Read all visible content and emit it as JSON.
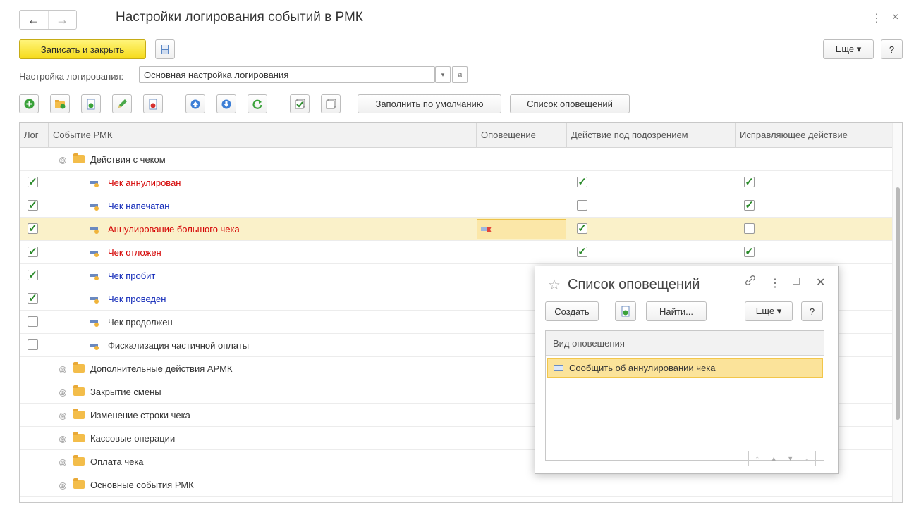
{
  "window": {
    "title": "Настройки логирования событий в РМК",
    "back_arrow": "←",
    "forward_arrow": "→",
    "more_icon": "⋮",
    "close_icon": "×"
  },
  "toolbar": {
    "save_close_label": "Записать и закрыть",
    "more_label": "Еще ▾",
    "help_label": "?"
  },
  "setting": {
    "label": "Настройка логирования:",
    "value": "Основная настройка логирования",
    "dropdown_icon": "▾",
    "open_icon": "⧉"
  },
  "actions": {
    "fill_default_label": "Заполнить по умолчанию",
    "notify_list_label": "Список оповещений"
  },
  "table": {
    "columns": [
      "Лог",
      "Событие РМК",
      "Оповещение",
      "Действие под подозрением",
      "Исправляющее действие"
    ],
    "rows": [
      {
        "type": "group",
        "expander": "⊖",
        "label": "Действия с чеком"
      },
      {
        "type": "event",
        "log": true,
        "label": "Чек аннулирован",
        "color": "#d40000",
        "suspect": true,
        "fix": true
      },
      {
        "type": "event",
        "log": true,
        "label": "Чек напечатан",
        "color": "#1028b8",
        "suspect": false,
        "fix": true
      },
      {
        "type": "event",
        "log": true,
        "label": "Аннулирование большого чека",
        "color": "#d40000",
        "suspect": true,
        "fix": false,
        "selected": true
      },
      {
        "type": "event",
        "log": true,
        "label": "Чек отложен",
        "color": "#d40000",
        "suspect": true,
        "fix": true
      },
      {
        "type": "event",
        "log": true,
        "label": "Чек пробит",
        "color": "#1028b8"
      },
      {
        "type": "event",
        "log": true,
        "label": "Чек проведен",
        "color": "#1028b8"
      },
      {
        "type": "event",
        "log": false,
        "label": "Чек продолжен",
        "color": "#333333"
      },
      {
        "type": "event",
        "log": false,
        "label": "Фискализация частичной оплаты",
        "color": "#333333"
      },
      {
        "type": "group",
        "expander": "⊕",
        "label": "Дополнительные действия АРМК"
      },
      {
        "type": "group",
        "expander": "⊕",
        "label": "Закрытие смены"
      },
      {
        "type": "group",
        "expander": "⊕",
        "label": "Изменение строки чека"
      },
      {
        "type": "group",
        "expander": "⊕",
        "label": "Кассовые операции"
      },
      {
        "type": "group",
        "expander": "⊕",
        "label": "Оплата чека"
      },
      {
        "type": "group",
        "expander": "⊕",
        "label": "Основные события РМК"
      }
    ]
  },
  "popup": {
    "star_icon": "☆",
    "title": "Список оповещений",
    "link_icon": "🔗",
    "more_icon": "⋮",
    "maximize_icon": "□",
    "close_icon": "✕",
    "create_label": "Создать",
    "find_label": "Найти...",
    "more_label": "Еще ▾",
    "help_label": "?",
    "column": "Вид оповещения",
    "item": "Сообщить об аннулировании чека"
  },
  "check_mark": "✓",
  "colors": {
    "accent_yellow": "#f6db1a",
    "selection": "#faf1c9",
    "check_green": "#2a8a2a"
  }
}
